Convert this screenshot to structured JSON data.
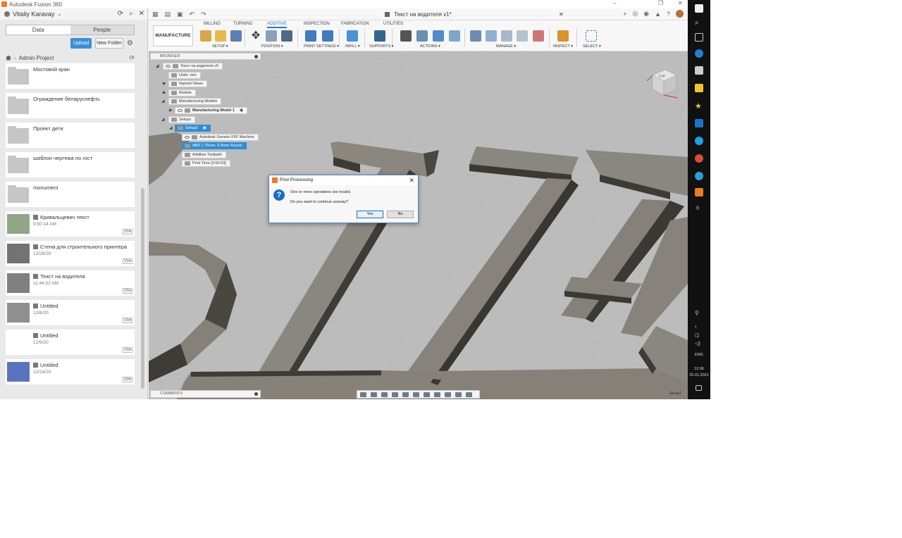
{
  "window": {
    "title": "Autodesk Fusion 360",
    "controls": [
      "–",
      "❐",
      "✕"
    ]
  },
  "data_panel": {
    "user": "Vitaliy Karavay",
    "tabs": [
      "Data",
      "People"
    ],
    "upload_label": "Upload",
    "new_folder_label": "New Folder",
    "breadcrumb": "Admin Project",
    "items": [
      {
        "kind": "folder",
        "name": "Мостовой кран",
        "date": "",
        "version": ""
      },
      {
        "kind": "folder",
        "name": "Ограждение беларуснефть",
        "date": "",
        "version": ""
      },
      {
        "kind": "folder",
        "name": "Проект дети",
        "date": "",
        "version": ""
      },
      {
        "kind": "folder",
        "name": "шаблон чертежа по гост",
        "date": "",
        "version": ""
      },
      {
        "kind": "folder",
        "name": "monument",
        "date": "",
        "version": ""
      },
      {
        "kind": "design",
        "name": "Кривальцевич текст",
        "date": "9:50:14 AM",
        "version": "V1▾"
      },
      {
        "kind": "design",
        "name": "Стена для строительного принтера",
        "date": "12/28/20",
        "version": "V1▾"
      },
      {
        "kind": "design",
        "name": "Текст на водителя",
        "date": "11:44:52 AM",
        "version": "V1▾"
      },
      {
        "kind": "design",
        "name": "Untitled",
        "date": "12/8/20",
        "version": "V1▾"
      },
      {
        "kind": "design",
        "name": "Untitled",
        "date": "12/9/20",
        "version": "V1▾"
      },
      {
        "kind": "design",
        "name": "Untitled",
        "date": "12/14/20",
        "version": "V2▾"
      }
    ]
  },
  "document": {
    "title": "Текст на водителя v1*"
  },
  "toolbar": {
    "workspace": "MANUFACTURE ▾",
    "tabs": [
      {
        "label": "MILLING",
        "active": false
      },
      {
        "label": "TURNING",
        "active": false
      },
      {
        "label": "ADDITIVE",
        "active": true
      },
      {
        "label": "INSPECTION",
        "active": false
      },
      {
        "label": "FABRICATION",
        "active": false
      },
      {
        "label": "UTILITIES",
        "active": false
      }
    ],
    "groups": [
      "SETUP ▾",
      "POSITION ▾",
      "PRINT SETTINGS ▾",
      "INFILL ▾",
      "SUPPORTS ▾",
      "ACTIONS ▾",
      "MANAGE ▾",
      "INSPECT ▾",
      "SELECT ▾"
    ]
  },
  "browser": {
    "header": "BROWSER",
    "nodes": [
      {
        "label": "Текст на водителя v0"
      },
      {
        "label": "Units: mm"
      },
      {
        "label": "Named Views"
      },
      {
        "label": "Models"
      },
      {
        "label": "Manufacturing Models"
      },
      {
        "label": "Manufacturing Model 1"
      },
      {
        "label": "Setups"
      },
      {
        "label": "Setup2"
      },
      {
        "label": "Autodesk Generic FFF Machine"
      },
      {
        "label": "ABS 1.75mm, 0.4mm Nozzle"
      },
      {
        "label": "Additive Toolpath"
      },
      {
        "label": "Print Time [3:55:03]"
      }
    ]
  },
  "dialog": {
    "title": "Post Processing",
    "message1": "One or more operations are invalid.",
    "message2": "Do you want to continue anyway?",
    "yes_label": "Yes",
    "no_label": "No",
    "close_glyph": "✕",
    "icon_glyph": "?"
  },
  "comments_label": "COMMENTS",
  "active_setup": "Setup2",
  "viewcube": {
    "face_label": "TOP"
  },
  "taskbar": {
    "lang": "ENG",
    "time": "12:06",
    "date": "25.01.2021"
  }
}
